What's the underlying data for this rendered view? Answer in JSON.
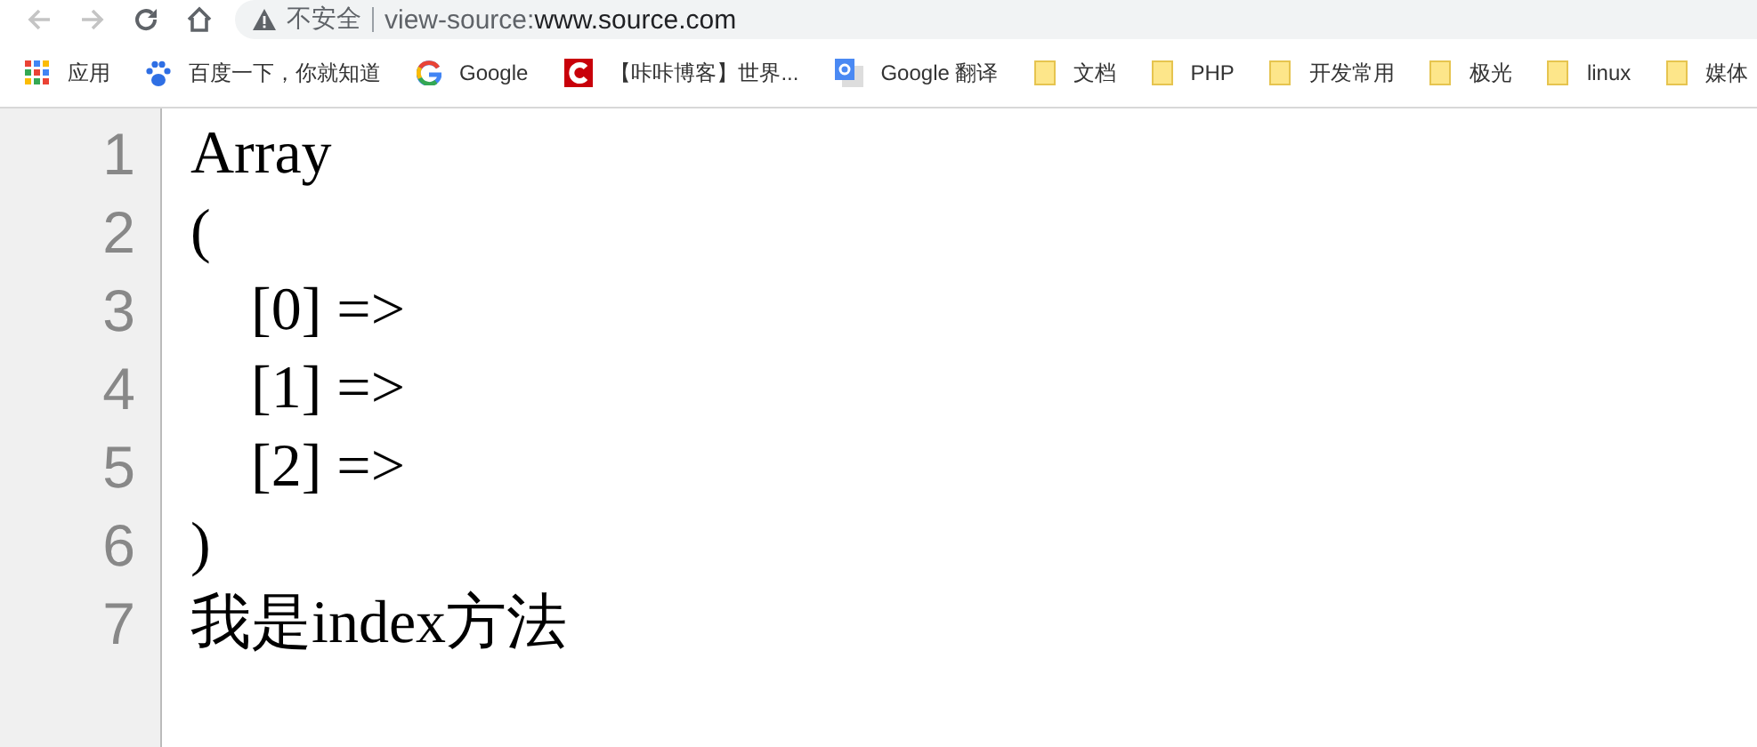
{
  "toolbar": {
    "security_label": "不安全",
    "url_scheme": "view-source:",
    "url_host": "www.source.com"
  },
  "bookmarks": [
    {
      "label": "应用",
      "kind": "apps"
    },
    {
      "label": "百度一下，你就知道",
      "kind": "paw"
    },
    {
      "label": "Google",
      "kind": "google"
    },
    {
      "label": "【咔咔博客】世界...",
      "kind": "redc"
    },
    {
      "label": "Google 翻译",
      "kind": "translate"
    },
    {
      "label": "文档",
      "kind": "folder"
    },
    {
      "label": "PHP",
      "kind": "folder"
    },
    {
      "label": "开发常用",
      "kind": "folder"
    },
    {
      "label": "极光",
      "kind": "folder"
    },
    {
      "label": "linux",
      "kind": "folder"
    },
    {
      "label": "媒体",
      "kind": "folder"
    }
  ],
  "source_lines": [
    {
      "number": "1",
      "text": "Array"
    },
    {
      "number": "2",
      "text": "("
    },
    {
      "number": "3",
      "text": "    [0] =>"
    },
    {
      "number": "4",
      "text": "    [1] =>"
    },
    {
      "number": "5",
      "text": "    [2] =>"
    },
    {
      "number": "6",
      "text": ")"
    },
    {
      "number": "7",
      "text": "我是index方法"
    }
  ]
}
